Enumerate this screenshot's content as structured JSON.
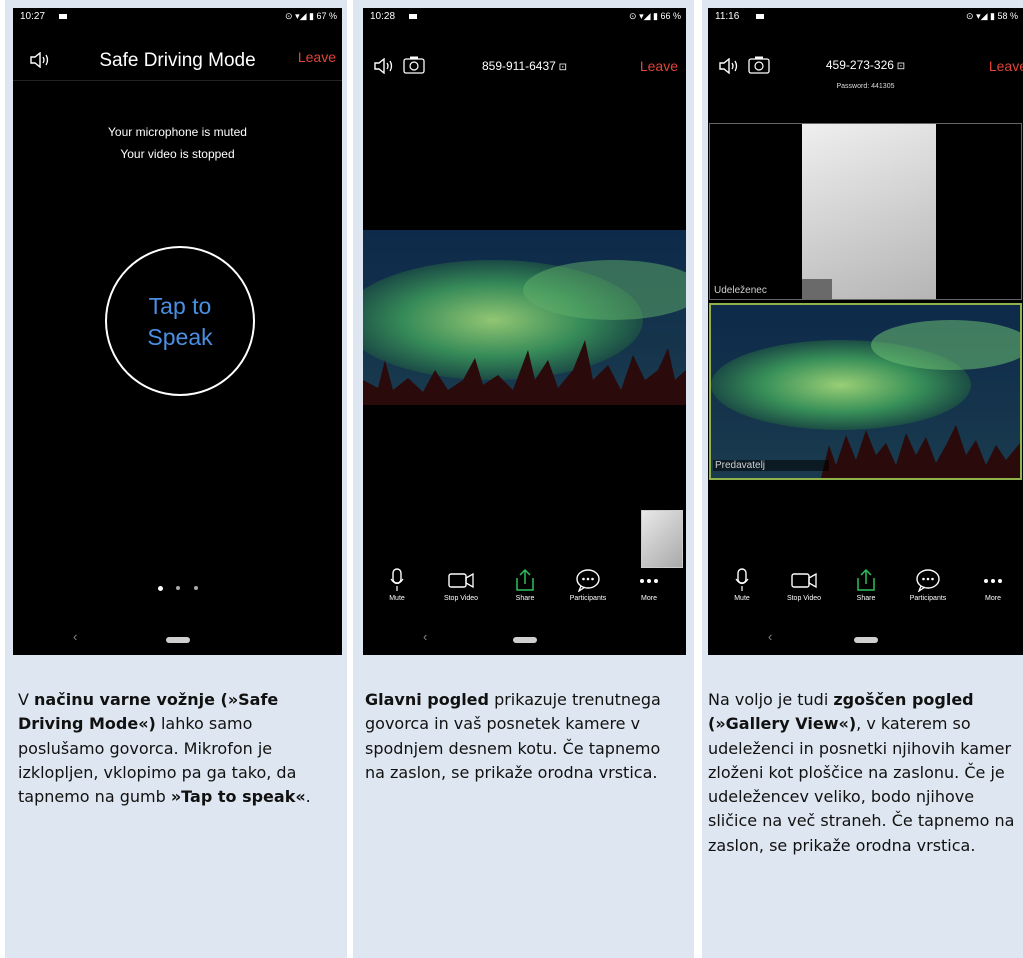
{
  "panels": [
    {
      "status": {
        "time": "10:27",
        "battery": "67 %"
      },
      "title": "Safe Driving Mode",
      "leave": "Leave",
      "muted_line1": "Your microphone is muted",
      "muted_line2": "Your video is stopped",
      "tap_line1": "Tap to",
      "tap_line2": "Speak",
      "caption": {
        "s1": "V ",
        "b1": "načinu varne vožnje (»Safe Driving Mode«)",
        "s2": " lahko samo poslušamo govorca. Mikrofon je izklopljen, vklopimo pa ga tako, da tapnemo na gumb ",
        "b2": "»Tap to speak«",
        "s3": "."
      }
    },
    {
      "status": {
        "time": "10:28",
        "battery": "66 %"
      },
      "meeting_id": "859-911-6437",
      "leave": "Leave",
      "caption": {
        "b1": "Glavni pogled",
        "s1": " prikazuje trenutnega govorca in vaš posnetek kamere v spodnjem desnem kotu. Če tapnemo na zaslon, se prikaže orodna vrstica."
      }
    },
    {
      "status": {
        "time": "11:16",
        "battery": "58 %"
      },
      "meeting_id": "459-273-326",
      "password": "Password: 441305",
      "leave": "Leave",
      "tile1_label": "Udeleženec",
      "tile2_label": "Predavatelj",
      "caption": {
        "s1": "Na voljo je tudi ",
        "b1": "zgoščen pogled (»Gallery View«)",
        "s2": ", v katerem so udeleženci in posnetki njihovih kamer zloženi kot ploščice na zaslonu. Če je udeležencev veliko, bodo njihove sličice na več straneh. Če tapnemo na zaslon, se prikaže orodna vrstica."
      }
    }
  ],
  "toolbar": {
    "mute": "Mute",
    "stop_video": "Stop Video",
    "share": "Share",
    "participants": "Participants",
    "more": "More"
  },
  "colors": {
    "leave": "#e0443a",
    "tap_text": "#4a90e2",
    "share": "#2fbf5b",
    "speaker_border": "#8fb34a",
    "panel_bg": "#dee7f1"
  }
}
